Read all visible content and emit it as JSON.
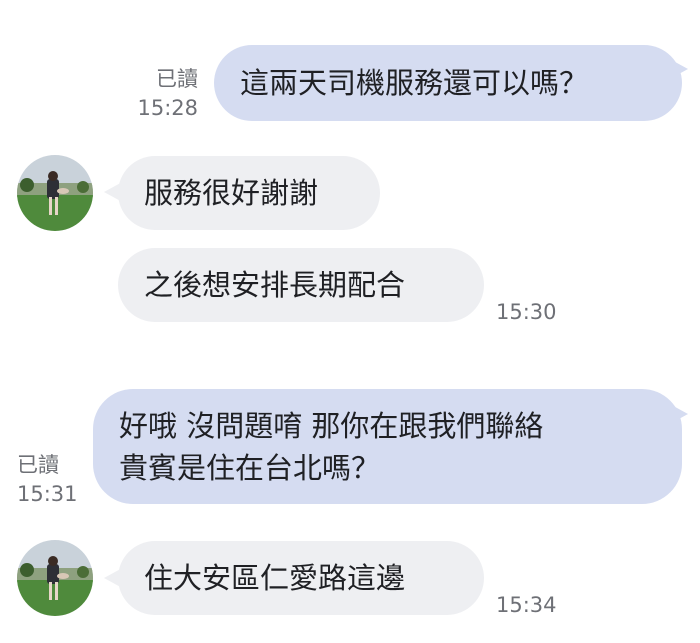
{
  "messages": [
    {
      "lines": [
        "這兩天司機服務還可以嗎？"
      ],
      "read_label": "已讀",
      "time": "15:28"
    },
    {
      "lines": [
        "服務很好謝謝"
      ]
    },
    {
      "lines": [
        "之後想安排長期配合"
      ],
      "time": "15:30"
    },
    {
      "lines": [
        "好哦 沒問題唷 那你在跟我們聯絡",
        "貴賓是住在台北嗎？"
      ],
      "read_label": "已讀",
      "time": "15:31"
    },
    {
      "lines": [
        "住大安區仁愛路這邊"
      ],
      "time": "15:34"
    }
  ],
  "colors": {
    "outgoing_bubble": "#d5dcf1",
    "incoming_bubble": "#eeeff2",
    "meta_text": "#6e7076"
  },
  "icons": {
    "contact_avatar": "contact-avatar-photo"
  }
}
